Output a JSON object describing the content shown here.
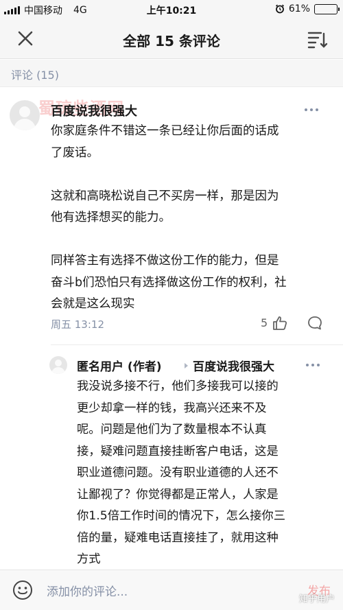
{
  "status_bar": {
    "carrier": "中国移动",
    "network": "4G",
    "time": "上午10:21",
    "battery_percent": "61%",
    "battery_level": 0.61
  },
  "header": {
    "title": "全部 15 条评论",
    "close_icon": "close-icon",
    "sort_icon": "sort-icon"
  },
  "section": {
    "label": "评论 (15)"
  },
  "comments": [
    {
      "author": "百度说我很强大",
      "content": "你家庭条件不错这一条已经让你后面的话成\n了废话。\n\n这就和高晓松说自己不买房一样，那是因为\n他有选择想买的能力。\n\n同样答主有选择不做这份工作的能力，但是\n奋斗b们恐怕只有选择做这份工作的权利，社\n会就是这么现实",
      "time": "周五 13:12",
      "likes": "5",
      "watermark": "蜀琼些酒网"
    }
  ],
  "reply": {
    "author": "匿名用户 (作者)",
    "reply_to": "百度说我很强大",
    "content": "我没说多接不行，他们多接我可以接的\n更少却拿一样的钱，我高兴还来不及\n呢。问题是他们为了数量根本不认真\n接，疑难问题直接挂断客户电话，这是\n职业道德问题。没有职业道德的人还不\n让鄙视了？你觉得都是正常人，人家是\n你1.5倍工作时间的情况下，怎么接你三\n倍的量，疑难电话直接挂了，就用这种\n方式"
  },
  "input_bar": {
    "placeholder": "添加你的评论...",
    "send_label": "发布",
    "corner_mark": "知乎用户"
  },
  "colors": {
    "meta": "#8590a6",
    "send_disabled": "#f3a7a7",
    "background": "#f6f6f6"
  }
}
